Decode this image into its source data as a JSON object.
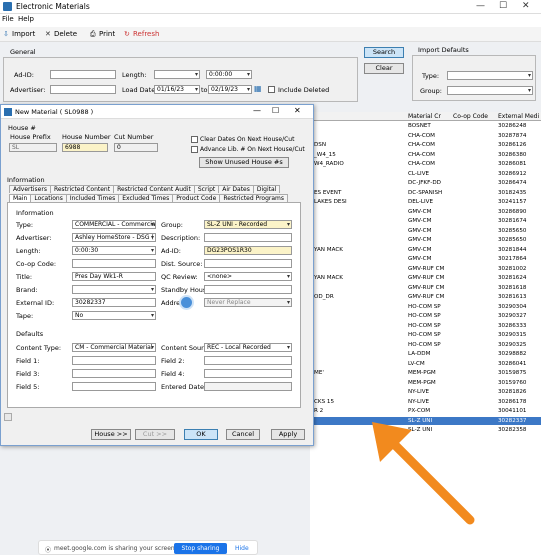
{
  "app": {
    "title": "Electronic Materials",
    "menu": [
      "File",
      "Help"
    ]
  },
  "toolbar": {
    "import": "Import",
    "delete": "Delete",
    "print": "Print",
    "refresh": "Refresh"
  },
  "general": {
    "label": "General",
    "adid": "Ad-ID:",
    "advertiser": "Advertiser:",
    "length": "Length:",
    "length_val": "0:00:00",
    "load_date": "Load Date:",
    "date_from": "01/16/23",
    "to": "to",
    "date_to": "02/19/23",
    "include_deleted": "Include Deleted",
    "search": "Search",
    "clear": "Clear",
    "import_defaults": "Import Defaults",
    "type": "Type:",
    "group": "Group:"
  },
  "grid": {
    "col_material": "Material Cr",
    "col_coop": "Co-op Code",
    "col_external": "External Medi",
    "rows": [
      {
        "a": "",
        "b": "BOSNET",
        "c": "30286248"
      },
      {
        "a": "",
        "b": "CHA-COM",
        "c": "30287874"
      },
      {
        "a": "DSN",
        "b": "CHA-COM",
        "c": "30286126"
      },
      {
        "a": "_W4_15",
        "b": "CHA-COM",
        "c": "30286380"
      },
      {
        "a": "W4_RADIO",
        "b": "CHA-COM",
        "c": "30286081"
      },
      {
        "a": "",
        "b": "CL-LIVE",
        "c": "30286912"
      },
      {
        "a": "",
        "b": "DC-JFKF-DD",
        "c": "30286474"
      },
      {
        "a": "ES EVENT",
        "b": "DC-SPANISH",
        "c": "30182435"
      },
      {
        "a": "LAKES DESI",
        "b": "DEL-LIVE",
        "c": "30241157"
      },
      {
        "a": "",
        "b": "GMV-CM",
        "c": "30286890"
      },
      {
        "a": "",
        "b": "GMV-CM",
        "c": "30281674"
      },
      {
        "a": "",
        "b": "GMV-CM",
        "c": "30285650"
      },
      {
        "a": "",
        "b": "GMV-CM",
        "c": "30285650"
      },
      {
        "a": "YAN MACK",
        "b": "GMV-CM",
        "c": "30281844"
      },
      {
        "a": "",
        "b": "GMV-CM",
        "c": "30217864"
      },
      {
        "a": "",
        "b": "GMV-RUF CM",
        "c": "30281002"
      },
      {
        "a": "YAN MACK",
        "b": "GMV-RUF CM",
        "c": "30281624"
      },
      {
        "a": "",
        "b": "GMV-RUF CM",
        "c": "30281618"
      },
      {
        "a": "OD_DR",
        "b": "GMV-RUF CM",
        "c": "30281613"
      },
      {
        "a": "",
        "b": "HO-COM SP",
        "c": "30290304"
      },
      {
        "a": "",
        "b": "HO-COM SP",
        "c": "30290327"
      },
      {
        "a": "",
        "b": "HO-COM SP",
        "c": "30286333"
      },
      {
        "a": "",
        "b": "HO-COM SP",
        "c": "30290315"
      },
      {
        "a": "",
        "b": "HO-COM SP",
        "c": "30290325"
      },
      {
        "a": "",
        "b": "LA-DDM",
        "c": "30298882"
      },
      {
        "a": "",
        "b": "LV-CM",
        "c": "30286041"
      },
      {
        "a": "ME'",
        "b": "MEM-PGM",
        "c": "30159875"
      },
      {
        "a": "",
        "b": "MEM-PGM",
        "c": "30159760"
      },
      {
        "a": "",
        "b": "NY-LIVE",
        "c": "30281826"
      },
      {
        "a": "CKS 15",
        "b": "NY-LIVE",
        "c": "30286178"
      },
      {
        "a": "R 2",
        "b": "PX-COM",
        "c": "30041101"
      },
      {
        "a": "",
        "b": "SL-Z UNI",
        "c": "30282337",
        "sel": true
      },
      {
        "a": "",
        "b": "SL-Z UNI",
        "c": "30282358"
      }
    ]
  },
  "dialog": {
    "title": "New Material ( SL0988 )",
    "house_section": "House #",
    "house_prefix": "House Prefix",
    "house_number": "House Number",
    "cut_number": "Cut Number",
    "prefix_val": "SL",
    "number_val": "6988",
    "cut_val": "0",
    "clear_dates": "Clear Dates On Next House/Cut",
    "advance": "Advance Lib. # On Next House/Cut",
    "show_unused": "Show Unused House #s",
    "information": "Information",
    "tabs_row1": [
      "Advertisers",
      "Restricted Content",
      "Restricted Content Audit",
      "Script",
      "Air Dates",
      "Digital"
    ],
    "tabs_row2": [
      "Main",
      "Locations",
      "Included Times",
      "Excluded Times",
      "Product Code",
      "Restricted Programs"
    ],
    "info_label": "Information",
    "type": "Type:",
    "type_val": "COMMERCIAL - Commercial",
    "advertiser": "Advertiser:",
    "advertiser_val": "Ashley HomeStore - DSG (",
    "length": "Length:",
    "length_val": "0:00:30",
    "coop": "Co-op Code:",
    "title_lbl": "Title:",
    "title_val": "Pres Day Wk1-R",
    "brand": "Brand:",
    "external_id": "External ID:",
    "external_val": "30282337",
    "tape": "Tape:",
    "tape_val": "No",
    "group": "Group:",
    "group_val": "SL-Z UNI - Recorded",
    "description": "Description:",
    "adid": "Ad-ID:",
    "adid_val": "DG23POS1R30",
    "dist_source": "Dist. Source:",
    "qc_review": "QC Review:",
    "qc_val": "<none>",
    "standby": "Standby House:",
    "address": "Address:",
    "address_val": "Never Replace",
    "defaults": "Defaults",
    "content_type": "Content Type:",
    "content_type_val": "CM - Commercial Material",
    "content_source": "Content Source:",
    "content_source_val": "REC - Local Recorded",
    "field1": "Field 1:",
    "field2": "Field 2:",
    "field3": "Field 3:",
    "field4": "Field 4:",
    "field5": "Field 5:",
    "entered_date": "Entered Date:",
    "house_btn": "House >>",
    "cut_btn": "Cut >>",
    "ok": "OK",
    "cancel": "Cancel",
    "apply": "Apply"
  },
  "share": {
    "text": "meet.google.com is sharing your screen.",
    "stop": "Stop sharing",
    "hide": "Hide"
  },
  "colors": {
    "arrow": "#f28a1e",
    "selected_row": "#3c78c6",
    "title_blue": "#2a6fb0"
  }
}
